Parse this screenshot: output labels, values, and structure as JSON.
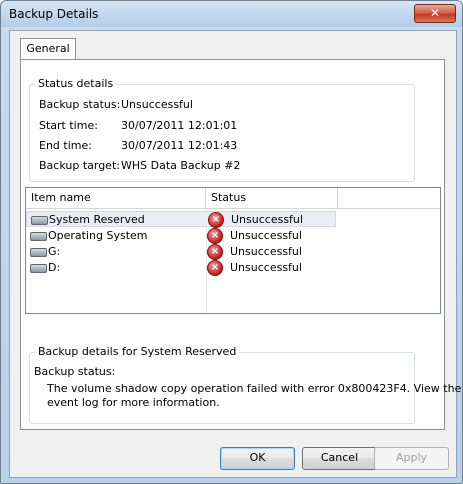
{
  "window": {
    "title": "Backup Details",
    "close_glyph": "✕"
  },
  "tabs": [
    {
      "label": "General"
    }
  ],
  "status_details": {
    "legend": "Status details",
    "rows": [
      {
        "label": "Backup status:",
        "value": "Unsuccessful"
      },
      {
        "label": "Start time:",
        "value": "30/07/2011 12:01:01"
      },
      {
        "label": "End time:",
        "value": "30/07/2011 12:01:43"
      },
      {
        "label": "Backup target:",
        "value": "WHS Data Backup #2"
      }
    ]
  },
  "items": {
    "columns": {
      "name": "Item name",
      "status": "Status"
    },
    "rows": [
      {
        "name": "System Reserved",
        "status": "Unsuccessful",
        "icon": "drive-icon",
        "status_icon": "error-icon"
      },
      {
        "name": "Operating System",
        "status": "Unsuccessful",
        "icon": "drive-icon",
        "status_icon": "error-icon"
      },
      {
        "name": "G:",
        "status": "Unsuccessful",
        "icon": "drive-icon",
        "status_icon": "error-icon"
      },
      {
        "name": "D:",
        "status": "Unsuccessful",
        "icon": "drive-icon",
        "status_icon": "error-icon"
      }
    ]
  },
  "backup_details": {
    "legend": "Backup details for System Reserved",
    "status_label": "Backup status:",
    "message_line1": "The volume shadow copy operation failed with error 0x800423F4. View the",
    "message_line2": "event log for more information."
  },
  "buttons": {
    "ok": "OK",
    "cancel": "Cancel",
    "apply": "Apply"
  },
  "colors": {
    "error": "#c11a1a",
    "selection": "#e9edf3",
    "close_button": "#c23b22"
  }
}
